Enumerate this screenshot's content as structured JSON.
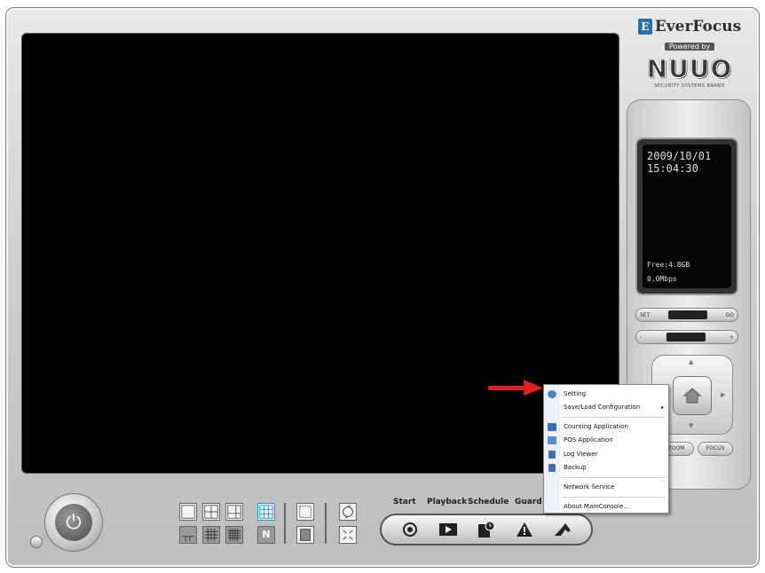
{
  "logo": {
    "brand": "EverFocus",
    "powered_by": "Powered by",
    "product": "NUUO",
    "tagline": "SECURITY SYSTEMS BRAND"
  },
  "lcd": {
    "date": "2009/10/01",
    "time": "15:04:30",
    "free": "Free:4.8GB",
    "rate": "0.0Mbps"
  },
  "panel": {
    "row1_left": "SET",
    "row1_right": "GO",
    "row2_left": "-",
    "row2_right": "+",
    "bottom_left": "ZOOM",
    "bottom_right": "FOCUS"
  },
  "toolbar": {
    "start": "Start",
    "playback": "Playback",
    "schedule": "Schedule",
    "guard": "Guard"
  },
  "layout_buttons": {
    "n_label": "N"
  },
  "context_menu": {
    "items": [
      {
        "label": "Setting",
        "icon": "gear-icon"
      },
      {
        "label": "Save/Load Configuration",
        "icon": "",
        "submenu": "▸"
      },
      {
        "label": "Counting Application",
        "icon": "counting-icon"
      },
      {
        "label": "POS Application",
        "icon": "pos-icon"
      },
      {
        "label": "Log Viewer",
        "icon": "log-icon"
      },
      {
        "label": "Backup",
        "icon": "backup-icon"
      },
      {
        "label": "Network Service",
        "icon": ""
      },
      {
        "label": "About MainConsole...",
        "icon": ""
      }
    ]
  },
  "colors": {
    "accent_blue": "#2a6fb0",
    "arrow_red": "#e0201c",
    "video_bg": "#000000"
  }
}
